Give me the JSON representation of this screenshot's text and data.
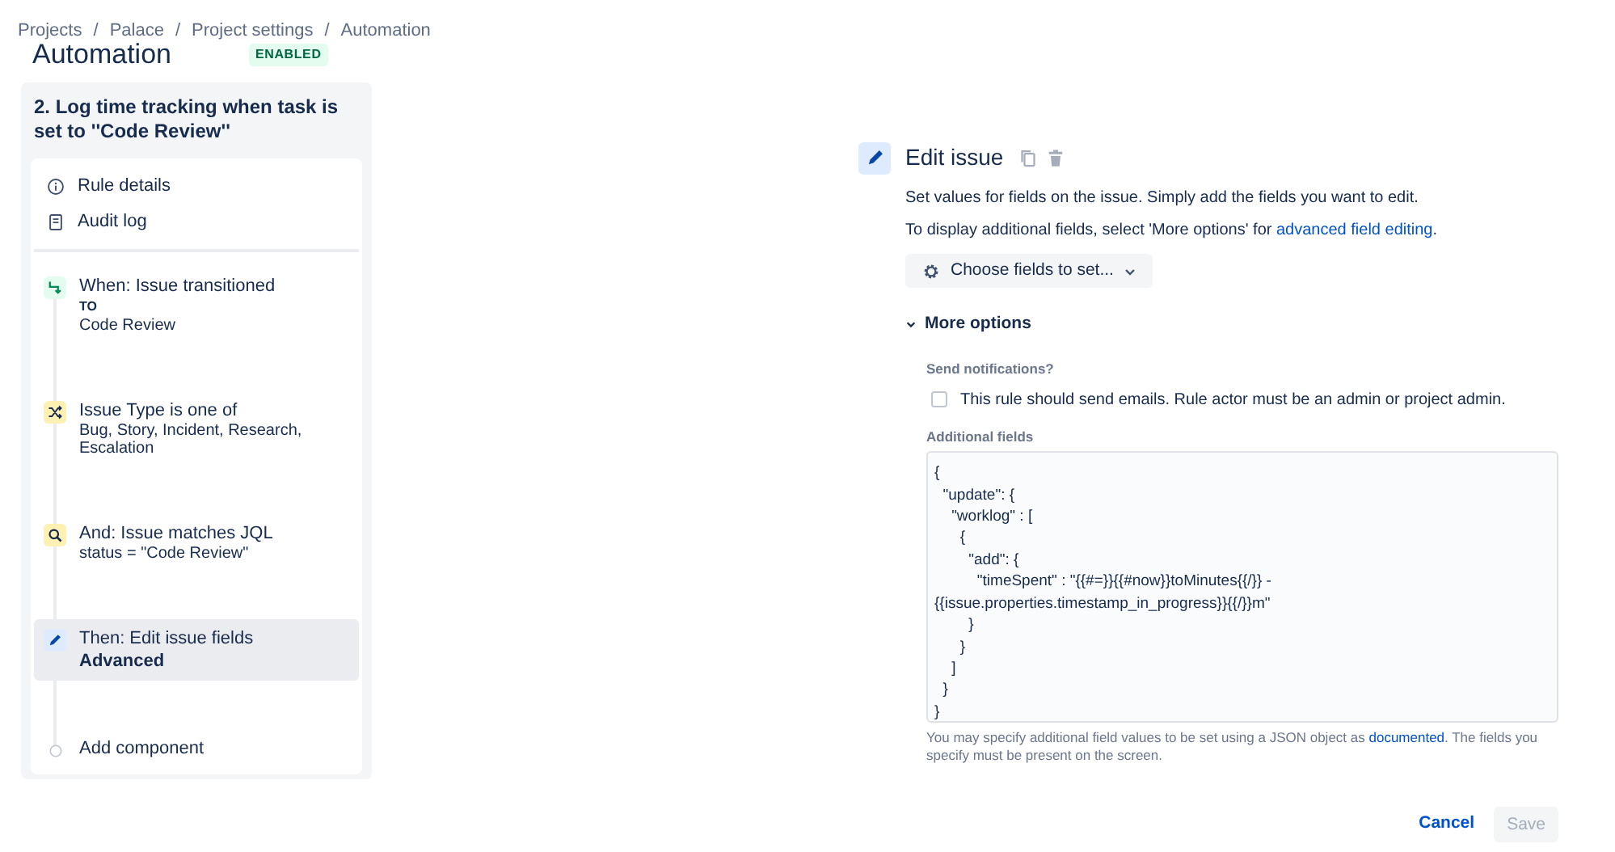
{
  "breadcrumbs": {
    "separator": "/",
    "items": [
      "Projects",
      "Palace",
      "Project settings",
      "Automation"
    ]
  },
  "page_title": "Automation",
  "status_badge": "ENABLED",
  "rule": {
    "title": "2. Log time tracking when task is set to ''Code Review''",
    "menu": [
      {
        "kind": "info",
        "label": "Rule details"
      },
      {
        "kind": "log",
        "label": "Audit log"
      }
    ],
    "steps": [
      {
        "kind": "trigger",
        "title": "When: Issue transitioned",
        "tag": "TO",
        "detail": "Code Review",
        "selected": false
      },
      {
        "kind": "condition",
        "title": "Issue Type is one of",
        "detail": "Bug, Story, Incident, Research, Escalation",
        "selected": false
      },
      {
        "kind": "jql",
        "title": "And: Issue matches JQL",
        "detail": "status = \"Code Review\"",
        "selected": false
      },
      {
        "kind": "action",
        "title": "Then: Edit issue fields",
        "detail_bold": "Advanced",
        "selected": true
      },
      {
        "kind": "add",
        "title": "Add component",
        "selected": false
      }
    ]
  },
  "editor": {
    "title": "Edit issue",
    "description": "Set values for fields on the issue. Simply add the fields you want to edit.",
    "more_info": "To display additional fields, select 'More options' for ",
    "more_info_link": "advanced field editing",
    "more_info_end": ".",
    "choose_button": "Choose fields to set...",
    "more_options": {
      "label": "More options",
      "expanded": true
    },
    "notifications": {
      "label": "Send notifications?",
      "checkbox_label": "This rule should send emails. Rule actor must be an admin or project admin.",
      "checked": false
    },
    "additional_fields": {
      "label": "Additional fields",
      "value": "{\n  \"update\": {\n    \"worklog\" : [\n      {\n        \"add\": {\n          \"timeSpent\" : \"{{#=}}{{#now}}toMinutes{{/}} - {{issue.properties.timestamp_in_progress}}{{/}}m\"\n        }\n      }\n    ]\n  }\n}"
    },
    "help": "You may specify additional field values to be set using a JSON object as ",
    "help_link": "documented",
    "help_end": ". The fields you specify must be present on the screen.",
    "cancel": "Cancel",
    "save": {
      "label": "Save",
      "disabled": true
    }
  }
}
